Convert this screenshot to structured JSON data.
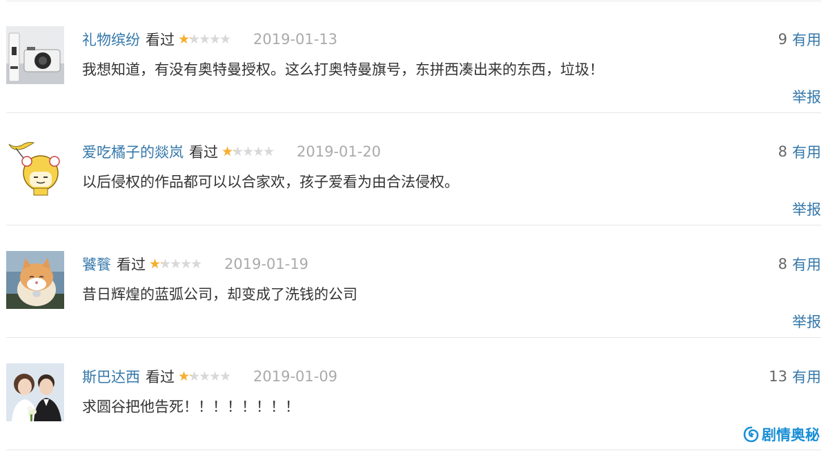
{
  "reviews": [
    {
      "username": "礼物缤纷",
      "watched": "看过",
      "rating_fraction": 0.2,
      "date": "2019-01-13",
      "vote_count": "9",
      "vote_label": "有用",
      "content": "我想知道，有没有奥特曼授权。这么打奥特曼旗号，东拼西凑出来的东西，垃圾！",
      "report_label": "举报",
      "avatar_icon": "camera-photo-icon"
    },
    {
      "username": "爱吃橘子的燚岚",
      "watched": "看过",
      "rating_fraction": 0.2,
      "date": "2019-01-20",
      "vote_count": "8",
      "vote_label": "有用",
      "content": "以后侵权的作品都可以以合家欢，孩子爱看为由合法侵权。",
      "report_label": "举报",
      "avatar_icon": "cartoon-character-icon"
    },
    {
      "username": "饕餮",
      "watched": "看过",
      "rating_fraction": 0.2,
      "date": "2019-01-19",
      "vote_count": "8",
      "vote_label": "有用",
      "content": "昔日辉煌的蓝弧公司，却变成了洗钱的公司",
      "report_label": "举报",
      "avatar_icon": "cat-photo-icon"
    },
    {
      "username": "斯巴达西",
      "watched": "看过",
      "rating_fraction": 0.2,
      "date": "2019-01-09",
      "vote_count": "13",
      "vote_label": "有用",
      "content": "求圆谷把他告死！！！！！！！！",
      "report_label": "",
      "avatar_icon": "couple-photo-icon"
    }
  ],
  "stars": {
    "glyphs": "★★★★★"
  },
  "watermark": {
    "text": "剧情奥秘",
    "icon": "logo-swirl-icon",
    "color": "#1a8fd6"
  },
  "colors": {
    "link": "#3377aa",
    "star": "#f6ae2d",
    "star_empty": "#d8d8d8",
    "date": "#aaaaaa",
    "separator": "#e6e6e6"
  }
}
